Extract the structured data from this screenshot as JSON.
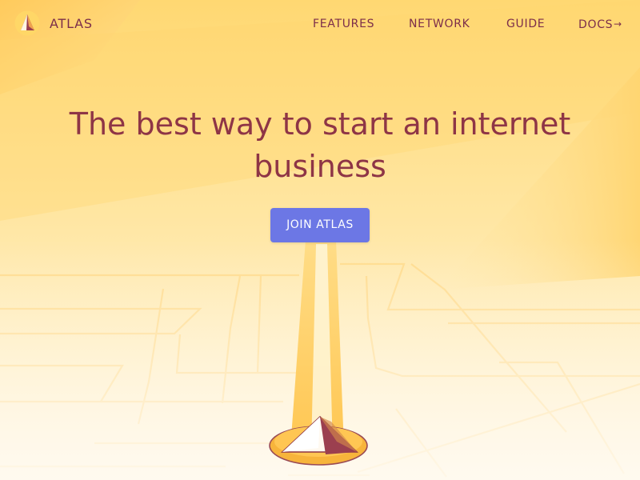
{
  "header": {
    "brand": "ATLAS",
    "logo_icon": "atlas-pyramid-logo",
    "nav": {
      "features": "FEATURES",
      "network": "NETWORK",
      "guide": "GUIDE",
      "docs": "DOCS",
      "docs_arrow": "→"
    }
  },
  "hero": {
    "title": "The best way to start an internet business",
    "cta_label": "JOIN ATLAS",
    "cta_color": "#6c77e5"
  },
  "colors": {
    "background_light": "#fff6de",
    "background_warm": "#ffd56b",
    "text_primary": "#7c2e4a",
    "title_color": "#8e3546"
  }
}
